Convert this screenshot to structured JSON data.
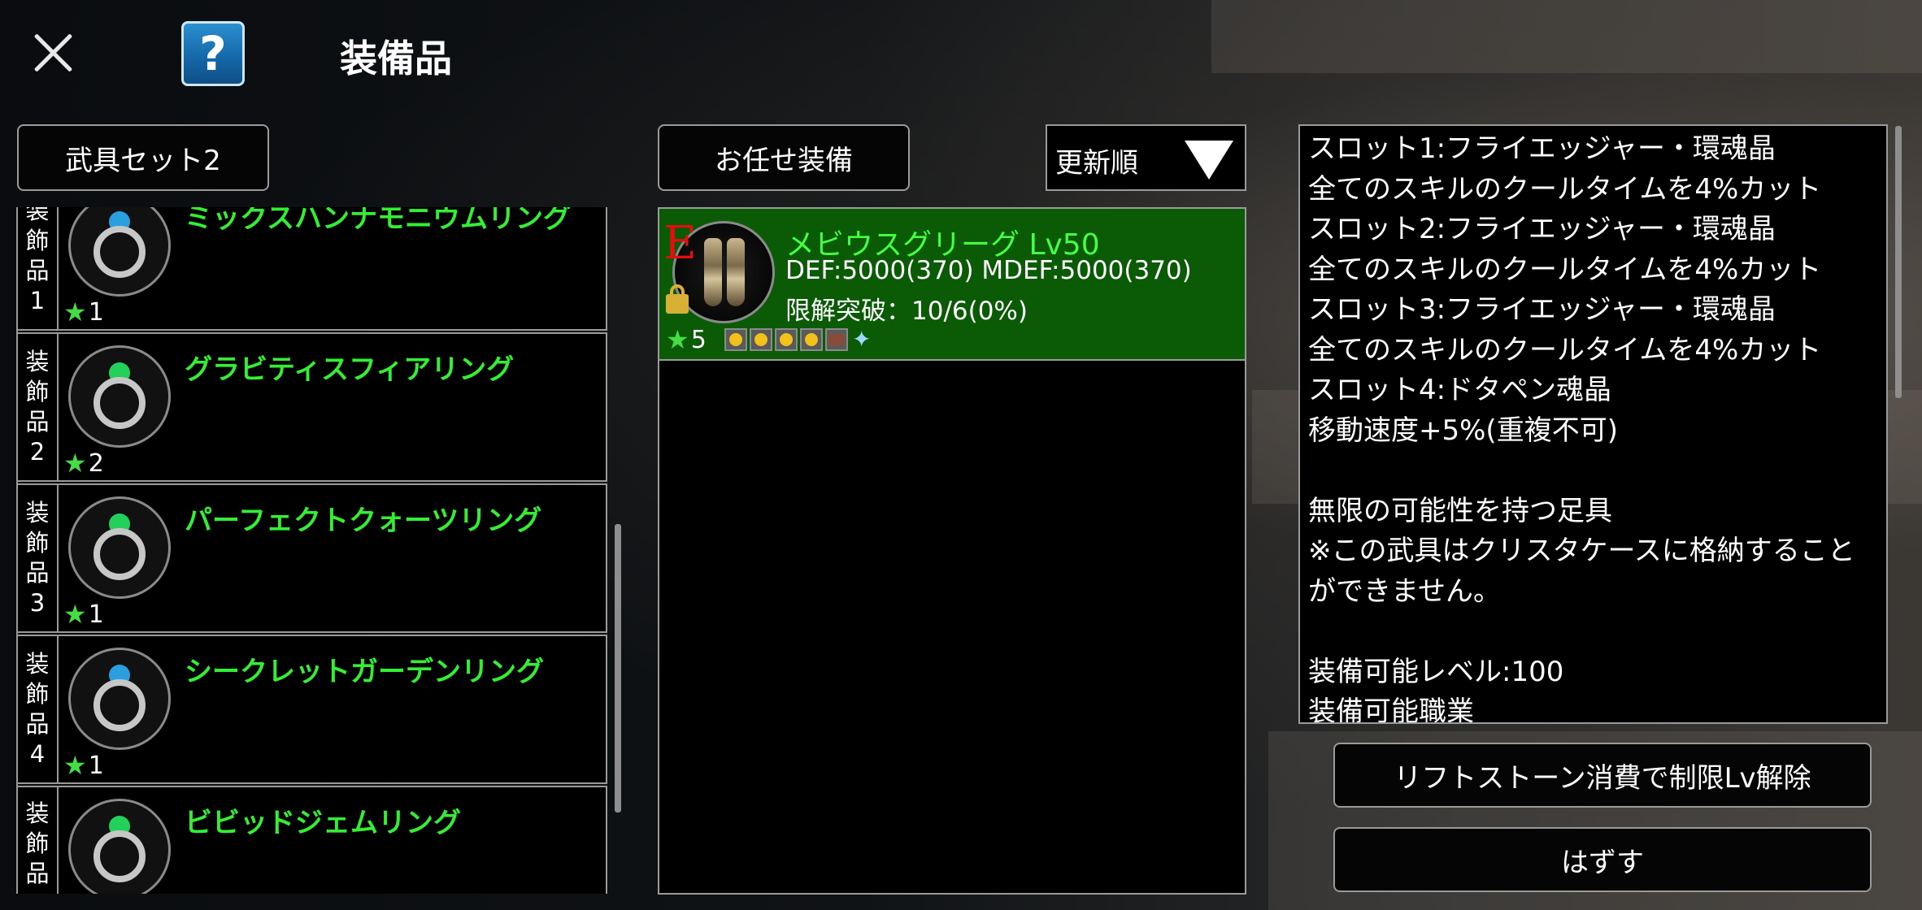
{
  "header": {
    "title": "装備品",
    "help_label": "?"
  },
  "buttons": {
    "weapon_set": "武具セット2",
    "auto_equip": "お任せ装備",
    "rift_stone": "リフトストーン消費で制限Lv解除",
    "unequip": "はずす"
  },
  "sort": {
    "label": "更新順"
  },
  "slots": [
    {
      "side": [
        "装",
        "飾",
        "品",
        "1"
      ],
      "name": "ミックスハンナモニウムリング",
      "rank": "1",
      "gem_color": "#2a9fe0"
    },
    {
      "side": [
        "装",
        "飾",
        "品",
        "2"
      ],
      "name": "グラビティスフィアリング",
      "rank": "2",
      "gem_color": "#22d05a"
    },
    {
      "side": [
        "装",
        "飾",
        "品",
        "3"
      ],
      "name": "パーフェクトクォーツリング",
      "rank": "1",
      "gem_color": "#22d05a"
    },
    {
      "side": [
        "装",
        "飾",
        "品",
        "4"
      ],
      "name": "シークレットガーデンリング",
      "rank": "1",
      "gem_color": "#2a9fe0"
    },
    {
      "side": [
        "装",
        "飾",
        "品"
      ],
      "name": "ビビッドジェムリング",
      "rank": "",
      "gem_color": "#22d05a"
    }
  ],
  "equipment": {
    "mark": "E",
    "name": "メビウスグリーグ Lv50",
    "stats": "DEF:5000(370) MDEF:5000(370)",
    "limit_break": "限解突破：10/6(0%)",
    "rank": "5"
  },
  "description": [
    "スロット1:フライエッジャー・環魂晶",
    "全てのスキルのクールタイムを4%カット",
    "スロット2:フライエッジャー・環魂晶",
    "全てのスキルのクールタイムを4%カット",
    "スロット3:フライエッジャー・環魂晶",
    "全てのスキルのクールタイムを4%カット",
    "スロット4:ドタペン魂晶",
    "移動速度+5%(重複不可)",
    "",
    "無限の可能性を持つ足具",
    "※この武具はクリスタケースに格納することができません。",
    "",
    "装備可能レベル:100",
    "装備可能職業"
  ],
  "icons": [
    "close-icon",
    "help-icon",
    "ring-icon",
    "star-icon",
    "lock-icon",
    "dropdown-arrow-icon",
    "greaves-icon"
  ]
}
